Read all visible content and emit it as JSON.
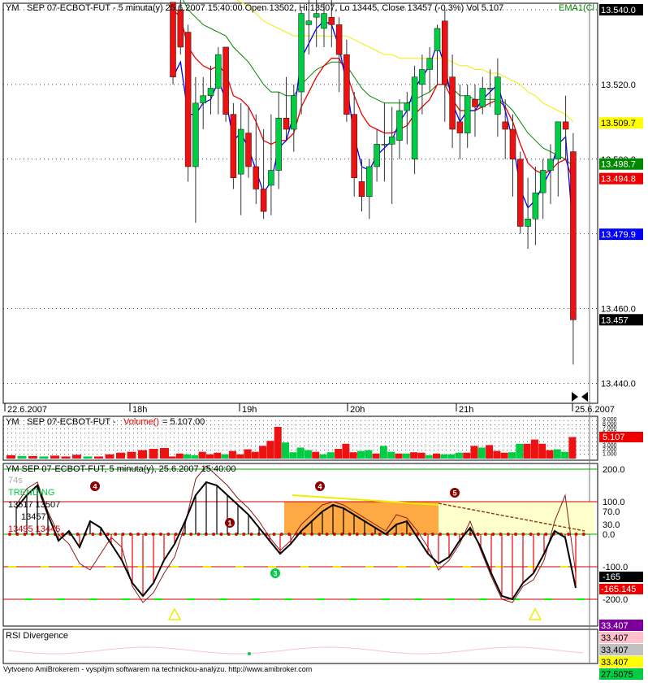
{
  "colors": {
    "up": "#00cc44",
    "down": "#ee1111",
    "ema_short": "#0000ff",
    "ema_mid": "#ee0000",
    "ema_mid2": "#008800",
    "ema_long": "#eeee00"
  },
  "price_pane": {
    "title_prefix": "YM",
    "title_main": "SEP 07-ECBOT-FUT - 5 minuta(y) 25.6.2007 15:40:00 Open 13502, Hi 13507, Lo 13445, Close 13457 (-0.3%) Vol 5.107",
    "title_ema": "EMA1(Cl",
    "y_ticks": [
      "13.540.0",
      "13.520.0",
      "13.500.0",
      "13.480.0",
      "13.460.0",
      "13.440.0"
    ],
    "badges": [
      {
        "text": "13.540.0",
        "value": 13540,
        "bg": "#000000",
        "fg": "#ffffff"
      },
      {
        "text": "13.509.7",
        "value": 13509.7,
        "bg": "#ffff00",
        "fg": "#000000"
      },
      {
        "text": "13.498.7",
        "value": 13498.7,
        "bg": "#008800",
        "fg": "#ffffff"
      },
      {
        "text": "13.494.8",
        "value": 13494.8,
        "bg": "#ee0000",
        "fg": "#ffffff"
      },
      {
        "text": "13.479.9",
        "value": 13479.9,
        "bg": "#0000ff",
        "fg": "#ffffff"
      },
      {
        "text": "13.457",
        "value": 13457,
        "bg": "#000000",
        "fg": "#ffffff"
      }
    ],
    "x_labels": [
      {
        "text": "22.6.2007",
        "bar": 0
      },
      {
        "text": "18h",
        "bar": 11
      },
      {
        "text": "19h",
        "bar": 21
      },
      {
        "text": "20h",
        "bar": 31
      },
      {
        "text": "21h",
        "bar": 41
      },
      {
        "text": "25.6.2007",
        "bar": 53
      }
    ]
  },
  "volume_pane": {
    "title_prefix": "YM",
    "title_main": "SEP 07-ECBOT-FUT - ",
    "title_fn": "Volume()",
    "title_val": " = 5.107.00",
    "y_ticks": [
      "9.000",
      "8.000",
      "7.000",
      "6.000",
      "5.000",
      "4.000",
      "3.000",
      "2.000",
      "1.000"
    ],
    "badge": "5.107"
  },
  "indicator_pane": {
    "title": "YM  SEP 07-ECBOT-FUT, 5 minuta(y), 25.6.2007 15:40:00",
    "text_74s": "74s",
    "text_trending": "TRENDING",
    "text_r1": "13517  13507",
    "text_r2": "13457",
    "text_r3": "13495  13445",
    "y_ticks": [
      "200.0",
      "100.0",
      "70.0",
      "30.0",
      "0.0",
      "-100.0",
      "-200.0"
    ],
    "badge_a": "-165",
    "badge_b": "-165.145",
    "markers": [
      "4",
      "1",
      "3",
      "4",
      "5"
    ]
  },
  "rsi_pane": {
    "title": "RSI Divergence",
    "badges": [
      {
        "text": "33.407",
        "bg": "#7a0099",
        "fg": "#ffffff"
      },
      {
        "text": "33.407",
        "bg": "#ffc0cb",
        "fg": "#000000"
      },
      {
        "text": "33.407",
        "bg": "#c0c0c0",
        "fg": "#000000"
      },
      {
        "text": "33.407",
        "bg": "#ffff00",
        "fg": "#000000"
      },
      {
        "text": "27.5075",
        "bg": "#00cc44",
        "fg": "#000000"
      }
    ]
  },
  "footer": "Vytvoeno AmiBrokerem - vyspilým softwarem na technickou-analýzu. http://www.amibroker.com",
  "chart_data": {
    "type": "candlestick",
    "title": "YM SEP 07-ECBOT-FUT - 5 minuta(y) 25.6.2007 15:40:00",
    "ylim": [
      13436,
      13542
    ],
    "candles": [
      [
        13542,
        13542,
        13520,
        13522
      ],
      [
        13540,
        13548,
        13528,
        13530
      ],
      [
        13534,
        13536,
        13494,
        13498
      ],
      [
        13498,
        13522,
        13483,
        13515
      ],
      [
        13515,
        13522,
        13508,
        13517
      ],
      [
        13517,
        13525,
        13512,
        13519
      ],
      [
        13519,
        13530,
        13512,
        13528
      ],
      [
        13530,
        13530,
        13510,
        13512
      ],
      [
        13512,
        13515,
        13492,
        13495
      ],
      [
        13496,
        13515,
        13485,
        13508
      ],
      [
        13507,
        13514,
        13495,
        13498
      ],
      [
        13498,
        13512,
        13488,
        13492
      ],
      [
        13492,
        13508,
        13484,
        13486
      ],
      [
        13493,
        13512,
        13485,
        13497
      ],
      [
        13497,
        13518,
        13492,
        13511
      ],
      [
        13511,
        13522,
        13505,
        13508
      ],
      [
        13508,
        13520,
        13502,
        13517
      ],
      [
        13518,
        13540,
        13512,
        13539
      ],
      [
        13536,
        13545,
        13528,
        13537
      ],
      [
        13538,
        13544,
        13530,
        13539
      ],
      [
        13535,
        13542,
        13530,
        13539
      ],
      [
        13538,
        13546,
        13530,
        13536
      ],
      [
        13536,
        13538,
        13518,
        13528
      ],
      [
        13528,
        13532,
        13510,
        13512
      ],
      [
        13512,
        13518,
        13490,
        13495
      ],
      [
        13494,
        13500,
        13486,
        13490
      ],
      [
        13490,
        13500,
        13484,
        13498
      ],
      [
        13498,
        13508,
        13494,
        13504
      ],
      [
        13504,
        13515,
        13494,
        13504
      ],
      [
        13504,
        13514,
        13488,
        13506
      ],
      [
        13505,
        13516,
        13500,
        13513
      ],
      [
        13513,
        13518,
        13504,
        13515
      ],
      [
        13500,
        13525,
        13496,
        13522
      ],
      [
        13520,
        13528,
        13512,
        13524
      ],
      [
        13524,
        13530,
        13518,
        13527
      ],
      [
        13529,
        13536,
        13520,
        13535
      ],
      [
        13537,
        13540,
        13510,
        13520
      ],
      [
        13522,
        13528,
        13503,
        13508
      ],
      [
        13510,
        13520,
        13500,
        13507
      ],
      [
        13507,
        13520,
        13503,
        13517
      ],
      [
        13516,
        13520,
        13506,
        13514
      ],
      [
        13514,
        13522,
        13512,
        13519
      ],
      [
        13519,
        13524,
        13514,
        13519
      ],
      [
        13512,
        13527,
        13506,
        13522
      ],
      [
        13510,
        13516,
        13500,
        13508
      ],
      [
        13508,
        13512,
        13490,
        13500
      ],
      [
        13500,
        13502,
        13480,
        13482
      ],
      [
        13482,
        13495,
        13476,
        13484
      ],
      [
        13484,
        13498,
        13477,
        13491
      ],
      [
        13491,
        13500,
        13484,
        13497
      ],
      [
        13497,
        13504,
        13488,
        13500
      ],
      [
        13500,
        13506,
        13490,
        13510
      ],
      [
        13510,
        13517,
        13500,
        13508
      ],
      [
        13502,
        13507,
        13445,
        13457
      ]
    ],
    "ema_fast": [
      13522,
      13526,
      13512,
      13512,
      13515,
      13516,
      13521,
      13516,
      13505,
      13507,
      13503,
      13497,
      13491,
      13494,
      13503,
      13505,
      13512,
      13527,
      13531,
      13535,
      13537,
      13536,
      13530,
      13520,
      13506,
      13498,
      13497,
      13501,
      13503,
      13505,
      13510,
      13513,
      13519,
      13522,
      13525,
      13531,
      13525,
      13515,
      13510,
      13513,
      13513,
      13516,
      13518,
      13520,
      13513,
      13505,
      13492,
      13487,
      13489,
      13493,
      13497,
      13504,
      13506,
      13480
    ],
    "ema_mid": [
      13540,
      13538,
      13530,
      13527,
      13525,
      13524,
      13525,
      13523,
      13517,
      13516,
      13514,
      13510,
      13505,
      13504,
      13505,
      13505,
      13507,
      13514,
      13518,
      13522,
      13525,
      13527,
      13527,
      13523,
      13517,
      13512,
      13509,
      13508,
      13507,
      13507,
      13508,
      13509,
      13512,
      13514,
      13516,
      13520,
      13520,
      13516,
      13513,
      13513,
      13513,
      13514,
      13515,
      13516,
      13514,
      13510,
      13504,
      13499,
      13497,
      13496,
      13497,
      13499,
      13500,
      13494
    ],
    "ema_mid2": [
      13545,
      13544,
      13540,
      13538,
      13536,
      13535,
      13534,
      13533,
      13530,
      13528,
      13526,
      13523,
      13520,
      13518,
      13518,
      13517,
      13517,
      13520,
      13522,
      13524,
      13525,
      13526,
      13526,
      13525,
      13522,
      13519,
      13517,
      13516,
      13515,
      13515,
      13515,
      13515,
      13516,
      13517,
      13518,
      13520,
      13520,
      13519,
      13517,
      13517,
      13516,
      13516,
      13516,
      13516,
      13515,
      13513,
      13510,
      13507,
      13505,
      13503,
      13502,
      13501,
      13500,
      13498
    ],
    "ema_slow": [
      13550,
      13550,
      13549,
      13548,
      13547,
      13546,
      13545,
      13544,
      13543,
      13542,
      13541,
      13539,
      13537,
      13536,
      13535,
      13534,
      13533,
      13533,
      13533,
      13533,
      13533,
      13533,
      13533,
      13533,
      13532,
      13531,
      13530,
      13529,
      13528,
      13528,
      13527,
      13527,
      13527,
      13527,
      13527,
      13527,
      13527,
      13526,
      13525,
      13525,
      13524,
      13524,
      13523,
      13523,
      13522,
      13521,
      13520,
      13518,
      13517,
      13515,
      13514,
      13513,
      13512,
      13510
    ],
    "volume": [
      [
        0.5,
        "r"
      ],
      [
        1.2,
        "r"
      ],
      [
        1.0,
        "g"
      ],
      [
        0.8,
        "g"
      ],
      [
        1.6,
        "r"
      ],
      [
        1.0,
        "r"
      ],
      [
        1.4,
        "r"
      ],
      [
        1.0,
        "g"
      ],
      [
        1.8,
        "r"
      ],
      [
        1.0,
        "r"
      ],
      [
        2.2,
        "r"
      ],
      [
        1.6,
        "r"
      ],
      [
        3.0,
        "r"
      ],
      [
        4.2,
        "r"
      ],
      [
        7.5,
        "r"
      ],
      [
        3.8,
        "g"
      ],
      [
        1.5,
        "g"
      ],
      [
        2.6,
        "g"
      ],
      [
        2.0,
        "g"
      ],
      [
        1.6,
        "r"
      ],
      [
        1.0,
        "g"
      ],
      [
        1.5,
        "g"
      ],
      [
        2.3,
        "r"
      ],
      [
        3.5,
        "r"
      ],
      [
        1.5,
        "r"
      ],
      [
        1.8,
        "g"
      ],
      [
        2.0,
        "g"
      ],
      [
        1.2,
        "r"
      ],
      [
        3.0,
        "g"
      ],
      [
        1.6,
        "g"
      ],
      [
        1.2,
        "r"
      ],
      [
        1.2,
        "g"
      ],
      [
        1.5,
        "r"
      ],
      [
        1.4,
        "r"
      ],
      [
        0.8,
        "g"
      ],
      [
        1.2,
        "r"
      ],
      [
        1.0,
        "g"
      ],
      [
        1.0,
        "g"
      ],
      [
        1.4,
        "g"
      ],
      [
        1.4,
        "r"
      ],
      [
        3.0,
        "r"
      ],
      [
        2.6,
        "g"
      ],
      [
        3.2,
        "r"
      ],
      [
        1.8,
        "r"
      ],
      [
        1.4,
        "r"
      ],
      [
        1.5,
        "g"
      ],
      [
        3.5,
        "g"
      ],
      [
        3.5,
        "r"
      ],
      [
        4.5,
        "r"
      ],
      [
        3.5,
        "r"
      ],
      [
        2.0,
        "r"
      ],
      [
        2.2,
        "g"
      ],
      [
        1.6,
        "g"
      ],
      [
        5.1,
        "r"
      ]
    ],
    "cci": [
      80,
      120,
      150,
      60,
      -20,
      10,
      -40,
      40,
      20,
      -30,
      -80,
      -150,
      -190,
      -150,
      -80,
      -30,
      40,
      120,
      160,
      150,
      120,
      90,
      60,
      20,
      -20,
      -60,
      -30,
      10,
      40,
      70,
      90,
      80,
      60,
      40,
      20,
      0,
      30,
      40,
      -10,
      -60,
      -90,
      -70,
      -20,
      20,
      -40,
      -120,
      -190,
      -200,
      -150,
      -120,
      -60,
      10,
      -10,
      -165
    ],
    "cci_overlay": [
      90,
      140,
      160,
      70,
      0,
      -30,
      -90,
      -110,
      -60,
      -10,
      -40,
      -160,
      -210,
      -180,
      -120,
      -70,
      30,
      170,
      210,
      180,
      150,
      110,
      80,
      40,
      -10,
      -50,
      -20,
      30,
      60,
      90,
      100,
      90,
      70,
      50,
      30,
      10,
      60,
      50,
      10,
      -40,
      -110,
      -80,
      -30,
      40,
      -50,
      -130,
      -200,
      -210,
      -160,
      -140,
      -80,
      40,
      120,
      -120
    ]
  }
}
